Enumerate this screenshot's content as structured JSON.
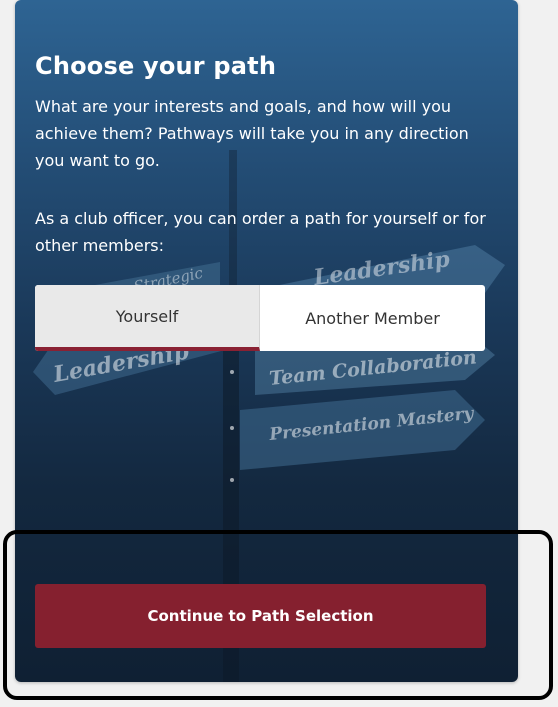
{
  "card": {
    "title": "Choose your path",
    "intro_text": "What are your interests and goals, and how will you achieve them? Pathways will take you in any direction you want to go.",
    "officer_text": "As a club officer, you can order a path for yourself or for other members:"
  },
  "toggle": {
    "options": [
      {
        "label": "Yourself",
        "selected": true
      },
      {
        "label": "Another Member",
        "selected": false
      }
    ]
  },
  "background_signs": {
    "left_top": "Strategic",
    "left_bottom": "Leadership",
    "right_1": "Leadership",
    "right_2": "Team Collaboration",
    "right_3": "Presentation Mastery"
  },
  "actions": {
    "continue_label": "Continue to Path Selection"
  },
  "colors": {
    "accent": "#85202f",
    "card_top": "#2e6493",
    "card_bottom": "#0f2033"
  }
}
